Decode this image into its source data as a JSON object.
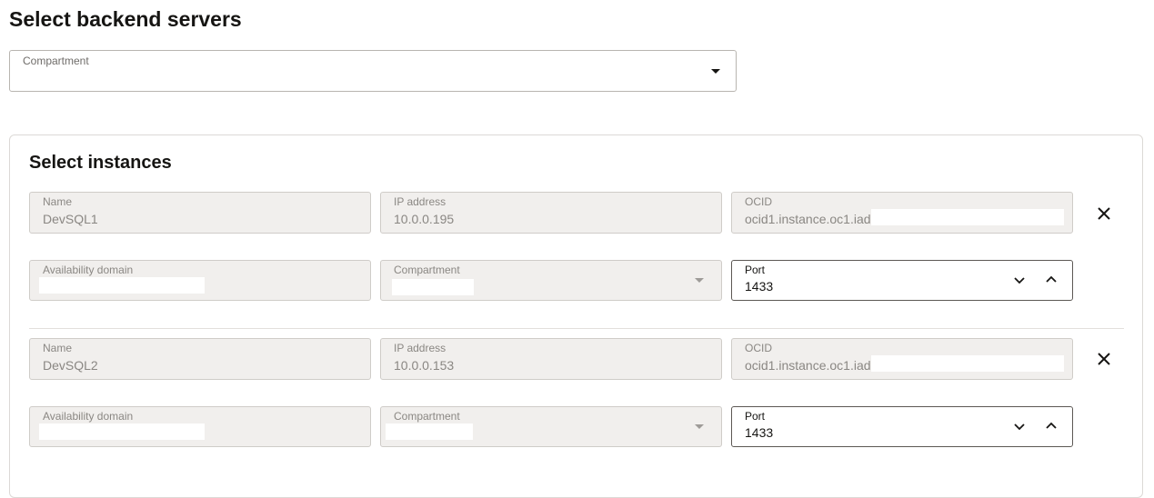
{
  "page": {
    "title": "Select backend servers"
  },
  "compartment_select": {
    "label": "Compartment",
    "value": ""
  },
  "instances_section": {
    "title": "Select instances"
  },
  "instances": [
    {
      "name_label": "Name",
      "name": "DevSQL1",
      "ip_label": "IP address",
      "ip": "10.0.0.195",
      "ocid_label": "OCID",
      "ocid": "ocid1.instance.oc1.iad.",
      "ad_label": "Availability domain",
      "ad": "",
      "compartment_label": "Compartment",
      "compartment": "",
      "port_label": "Port",
      "port": "1433"
    },
    {
      "name_label": "Name",
      "name": "DevSQL2",
      "ip_label": "IP address",
      "ip": "10.0.0.153",
      "ocid_label": "OCID",
      "ocid": "ocid1.instance.oc1.iad.",
      "ad_label": "Availability domain",
      "ad": "",
      "compartment_label": "Compartment",
      "compartment": "",
      "port_label": "Port",
      "port": "1433"
    }
  ],
  "icons": {
    "remove": "close-icon",
    "dropdown": "caret-down-icon",
    "decrement": "chevron-down-icon",
    "increment": "chevron-up-icon"
  },
  "colors": {
    "text": "#161513",
    "readonly_bg": "#f1efed",
    "border": "#b8b5b0"
  }
}
